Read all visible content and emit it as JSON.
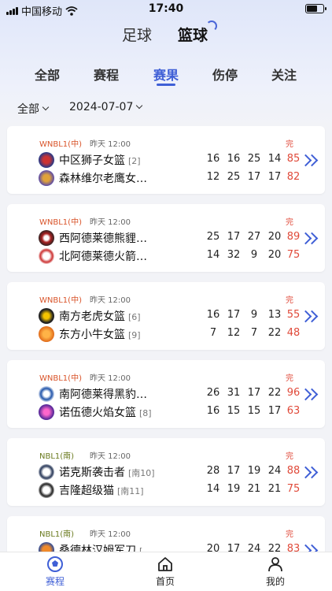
{
  "status_bar": {
    "carrier": "中国移动",
    "time": "17:40"
  },
  "sport_tabs": [
    {
      "label": "足球",
      "active": false
    },
    {
      "label": "篮球",
      "active": true
    }
  ],
  "filter_tabs": [
    {
      "label": "全部",
      "active": false
    },
    {
      "label": "赛程",
      "active": false
    },
    {
      "label": "赛果",
      "active": true
    },
    {
      "label": "伤停",
      "active": false
    },
    {
      "label": "关注",
      "active": false
    }
  ],
  "filters": {
    "category": "全部",
    "date": "2024-07-07"
  },
  "colors": {
    "accent": "#3f5fd6",
    "final_red": "#e04a3a",
    "league_orange": "#d9542a",
    "league_olive": "#6a7a1e"
  },
  "matches": [
    {
      "league": "WNBL1(中)",
      "time": "昨天 12:00",
      "status": "完",
      "home": {
        "name": "中区狮子女篮",
        "rank": "[2]",
        "quarters": [
          "16",
          "16",
          "25",
          "14"
        ],
        "total": "85"
      },
      "away": {
        "name": "森林维尔老鹰女…",
        "rank": "",
        "quarters": [
          "12",
          "25",
          "17",
          "17"
        ],
        "total": "82"
      }
    },
    {
      "league": "WNBL1(中)",
      "time": "昨天 12:00",
      "status": "完",
      "home": {
        "name": "西阿德莱德熊貍…",
        "rank": "",
        "quarters": [
          "25",
          "17",
          "27",
          "20"
        ],
        "total": "89"
      },
      "away": {
        "name": "北阿德莱德火箭…",
        "rank": "",
        "quarters": [
          "14",
          "32",
          "9",
          "20"
        ],
        "total": "75"
      }
    },
    {
      "league": "WNBL1(中)",
      "time": "昨天 12:00",
      "status": "完",
      "home": {
        "name": "南方老虎女篮",
        "rank": "[6]",
        "quarters": [
          "16",
          "17",
          "9",
          "13"
        ],
        "total": "55"
      },
      "away": {
        "name": "东方小牛女篮",
        "rank": "[9]",
        "quarters": [
          "7",
          "12",
          "7",
          "22"
        ],
        "total": "48"
      }
    },
    {
      "league": "WNBL1(中)",
      "time": "昨天 12:00",
      "status": "完",
      "home": {
        "name": "南阿德莱得黑豹…",
        "rank": "",
        "quarters": [
          "26",
          "31",
          "17",
          "22"
        ],
        "total": "96"
      },
      "away": {
        "name": "诺伍德火焰女篮",
        "rank": "[8]",
        "quarters": [
          "16",
          "15",
          "15",
          "17"
        ],
        "total": "63"
      }
    },
    {
      "league": "NBL1(南)",
      "time": "昨天 12:00",
      "status": "完",
      "home": {
        "name": "诺克斯袭击者",
        "rank": "[南10]",
        "quarters": [
          "28",
          "17",
          "19",
          "24"
        ],
        "total": "88"
      },
      "away": {
        "name": "吉隆超级猫",
        "rank": "[南11]",
        "quarters": [
          "14",
          "19",
          "21",
          "21"
        ],
        "total": "75"
      }
    },
    {
      "league": "NBL1(南)",
      "time": "昨天 12:00",
      "status": "完",
      "home": {
        "name": "桑德林汉姆军刀",
        "rank": "[",
        "quarters": [
          "20",
          "17",
          "24",
          "22"
        ],
        "total": "83"
      },
      "away": {
        "name": "",
        "rank": "",
        "quarters": [
          "",
          "",
          "",
          ""
        ],
        "total": ""
      }
    }
  ],
  "bottom_nav": [
    {
      "label": "赛程",
      "icon": "ball-icon",
      "active": true
    },
    {
      "label": "首页",
      "icon": "home-icon",
      "active": false
    },
    {
      "label": "我的",
      "icon": "user-icon",
      "active": false
    }
  ]
}
